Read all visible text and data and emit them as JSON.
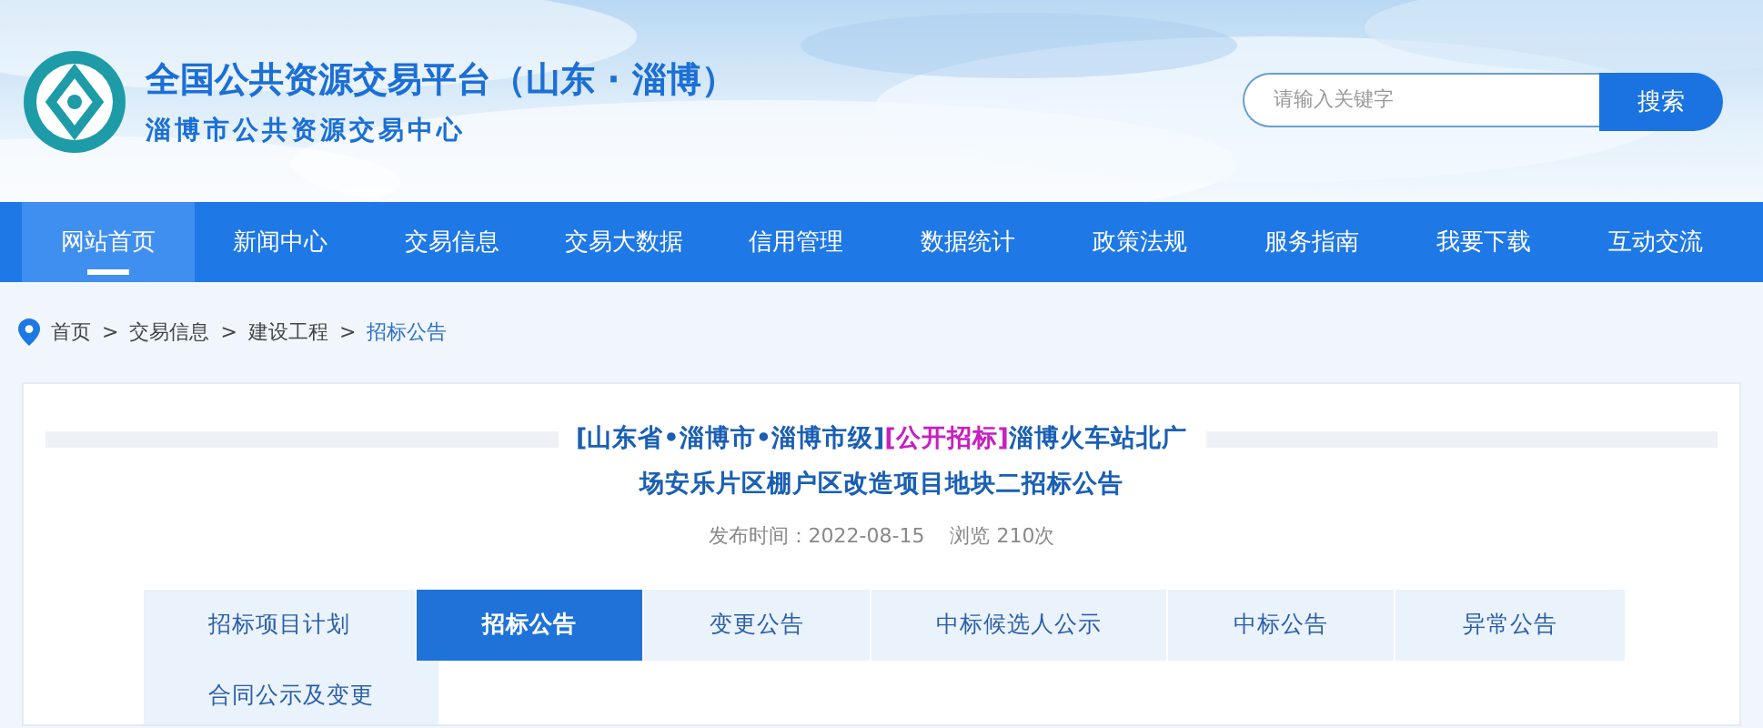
{
  "header": {
    "title": "全国公共资源交易平台（山东 · 淄博）",
    "subtitle": "淄博市公共资源交易中心",
    "search": {
      "placeholder": "请输入关键字",
      "button": "搜索"
    }
  },
  "nav": [
    {
      "label": "网站首页",
      "selected": true
    },
    {
      "label": "新闻中心",
      "selected": false
    },
    {
      "label": "交易信息",
      "selected": false
    },
    {
      "label": "交易大数据",
      "selected": false
    },
    {
      "label": "信用管理",
      "selected": false
    },
    {
      "label": "数据统计",
      "selected": false
    },
    {
      "label": "政策法规",
      "selected": false
    },
    {
      "label": "服务指南",
      "selected": false
    },
    {
      "label": "我要下载",
      "selected": false
    },
    {
      "label": "互动交流",
      "selected": false
    }
  ],
  "breadcrumb_separator": ">",
  "breadcrumb": [
    {
      "label": "首页",
      "current": false
    },
    {
      "label": "交易信息",
      "current": false
    },
    {
      "label": "建设工程",
      "current": false
    },
    {
      "label": "招标公告",
      "current": true
    }
  ],
  "article": {
    "title": [
      {
        "text": "[山东省•淄博市•淄博市级]",
        "color": "#1a5fb4"
      },
      {
        "text": "[公开招标]",
        "color": "#c81fc0"
      },
      {
        "text": "淄博火车站北广场安乐片区棚户区改造项目地块二招标公告",
        "color": "#1a5fb4"
      }
    ],
    "meta": [
      "发布时间：2022-08-15",
      "浏览 210次"
    ],
    "tabs": [
      {
        "label": "招标项目计划",
        "selected": false
      },
      {
        "label": "招标公告",
        "selected": true
      },
      {
        "label": "变更公告",
        "selected": false
      },
      {
        "label": "中标候选人公示",
        "selected": false
      },
      {
        "label": "中标公告",
        "selected": false
      },
      {
        "label": "异常公告",
        "selected": false
      },
      {
        "label": "合同公示及变更",
        "selected": false
      }
    ]
  }
}
